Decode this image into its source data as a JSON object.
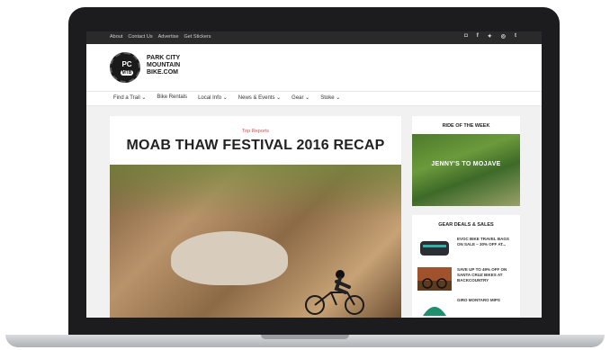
{
  "topbar": {
    "links": [
      "About",
      "Contact Us",
      "Advertise",
      "Get Stickers"
    ],
    "social": [
      "◘",
      "f",
      "✦",
      "◎",
      "t"
    ]
  },
  "logo": {
    "top": "PC",
    "badge": "MTB",
    "name_line1": "PARK CITY",
    "name_line2": "MOUNTAIN",
    "name_line3": "BIKE.COM"
  },
  "nav": {
    "items": [
      "Find a Trail ⌄",
      "Bike Rentals",
      "Local Info ⌄",
      "News & Events ⌄",
      "Gear ⌄",
      "Stoke ⌄"
    ]
  },
  "article": {
    "category": "Trip Reports",
    "title": "MOAB THAW FESTIVAL 2016 RECAP"
  },
  "sidebar": {
    "ride_title": "RIDE OF THE WEEK",
    "ride_caption": "JENNY'S TO MOJAVE",
    "deals_title": "GEAR DEALS & SALES",
    "deals": [
      {
        "text": "EVOC BIKE TRAVEL BAGS ON SALE – 30% OFF AT..."
      },
      {
        "text": "SAVE UP TO 49% OFF ON SANTA CRUZ BIKES AT BACKCOUNTRY"
      },
      {
        "text": "GIRO MONTARO MIPS"
      }
    ]
  },
  "colors": {
    "accent": "#d9534f",
    "topbar": "#2a2a2a"
  }
}
